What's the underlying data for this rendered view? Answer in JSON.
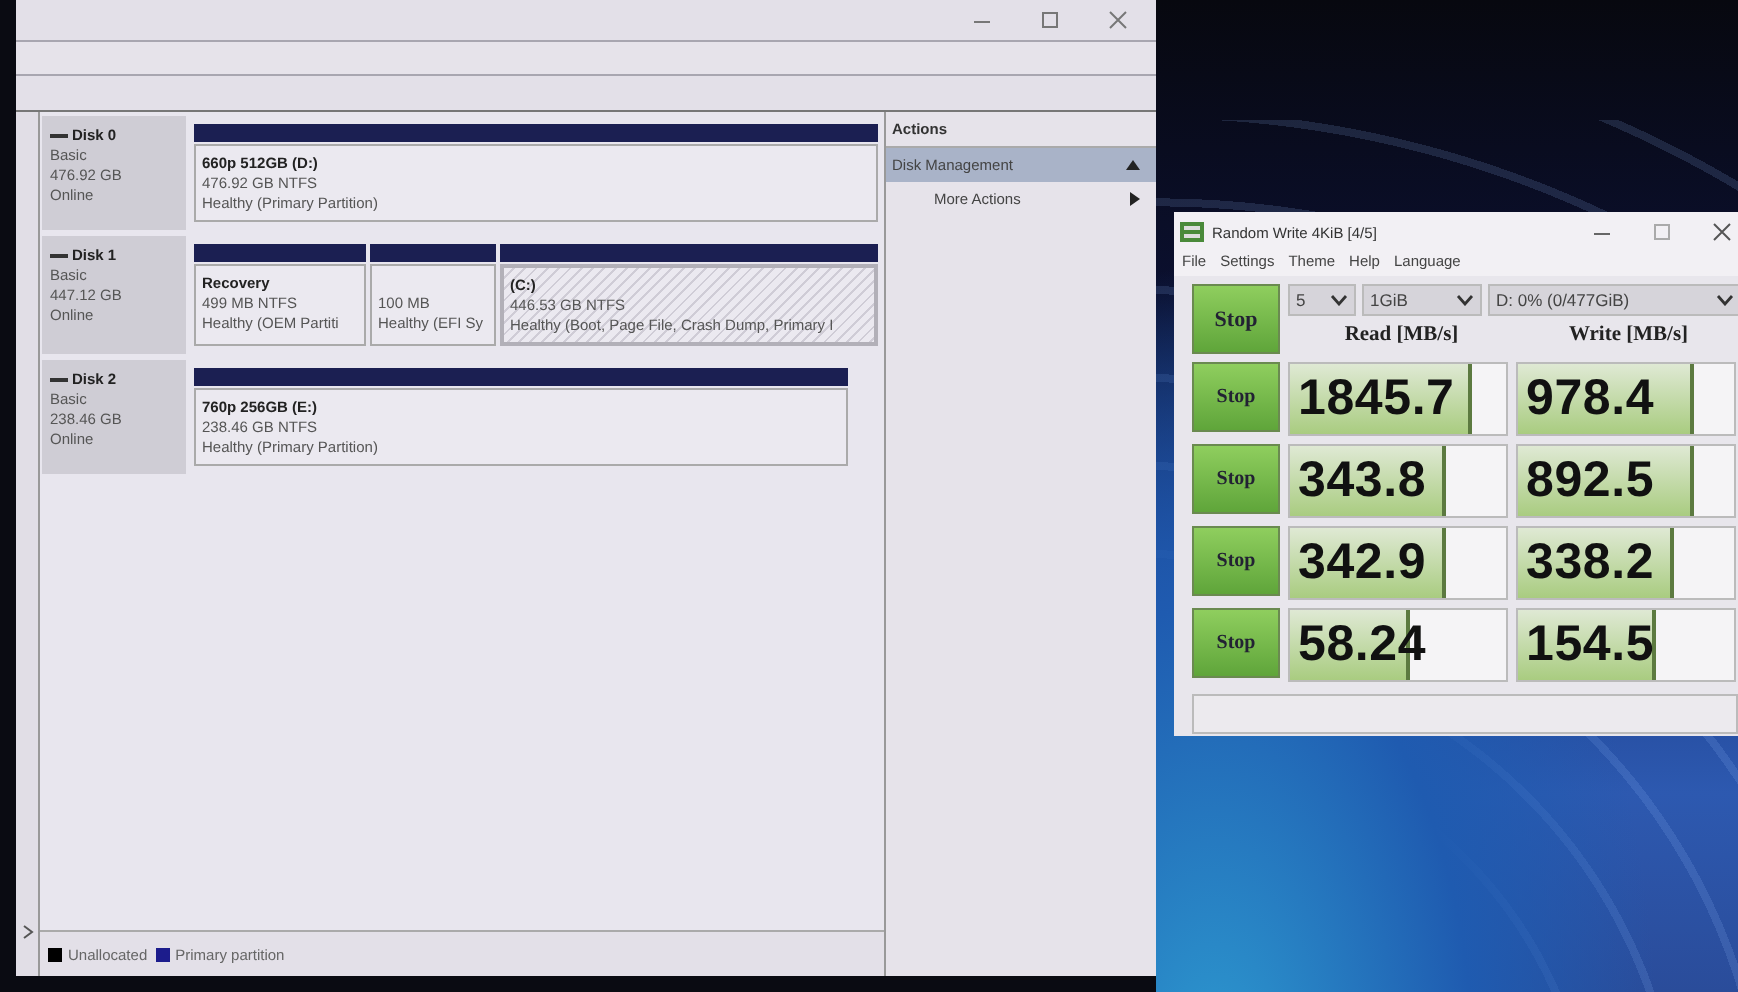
{
  "disk_management": {
    "disks": [
      {
        "name": "Disk 0",
        "type": "Basic",
        "size": "476.92 GB",
        "status": "Online",
        "partitions": [
          {
            "label": "660p 512GB  (D:)",
            "size": "476.92 GB NTFS",
            "health": "Healthy (Primary Partition)",
            "selected": false
          }
        ]
      },
      {
        "name": "Disk 1",
        "type": "Basic",
        "size": "447.12 GB",
        "status": "Online",
        "partitions": [
          {
            "label": "Recovery",
            "size": "499 MB NTFS",
            "health": "Healthy (OEM Partiti",
            "selected": false
          },
          {
            "size": "100 MB",
            "health": "Healthy (EFI Sy",
            "selected": false
          },
          {
            "label": "(C:)",
            "size": "446.53 GB NTFS",
            "health": "Healthy (Boot, Page File, Crash Dump, Primary I",
            "selected": true
          }
        ]
      },
      {
        "name": "Disk 2",
        "type": "Basic",
        "size": "238.46 GB",
        "status": "Online",
        "partitions": [
          {
            "label": "760p 256GB  (E:)",
            "size": "238.46 GB NTFS",
            "health": "Healthy (Primary Partition)",
            "selected": false
          }
        ]
      }
    ],
    "actions": {
      "title": "Actions",
      "items": [
        {
          "label": "Disk Management",
          "kind": "section",
          "selected": true
        },
        {
          "label": "More Actions",
          "kind": "submenu",
          "selected": false
        }
      ]
    },
    "legend": [
      {
        "label": "Unallocated",
        "color": "#000000"
      },
      {
        "label": "Primary partition",
        "color": "#1c1c8c"
      }
    ]
  },
  "benchmark": {
    "title": "Random Write 4KiB [4/5]",
    "menu": [
      "File",
      "Settings",
      "Theme",
      "Help",
      "Language"
    ],
    "all_button": "Stop",
    "count": "5",
    "size": "1GiB",
    "drive": "D: 0% (0/477GiB)",
    "headers": [
      "Read [MB/s]",
      "Write [MB/s]"
    ],
    "rows": [
      {
        "button": "Stop",
        "read": {
          "value": "1845.7",
          "level": 0.82
        },
        "write": {
          "value": "978.4",
          "level": 0.8
        }
      },
      {
        "button": "Stop",
        "read": {
          "value": "343.8",
          "level": 0.7
        },
        "write": {
          "value": "892.5",
          "level": 0.8
        }
      },
      {
        "button": "Stop",
        "read": {
          "value": "342.9",
          "level": 0.7
        },
        "write": {
          "value": "338.2",
          "level": 0.7
        }
      },
      {
        "button": "Stop",
        "read": {
          "value": "58.24",
          "level": 0.54
        },
        "write": {
          "value": "154.5",
          "level": 0.62
        }
      }
    ]
  }
}
